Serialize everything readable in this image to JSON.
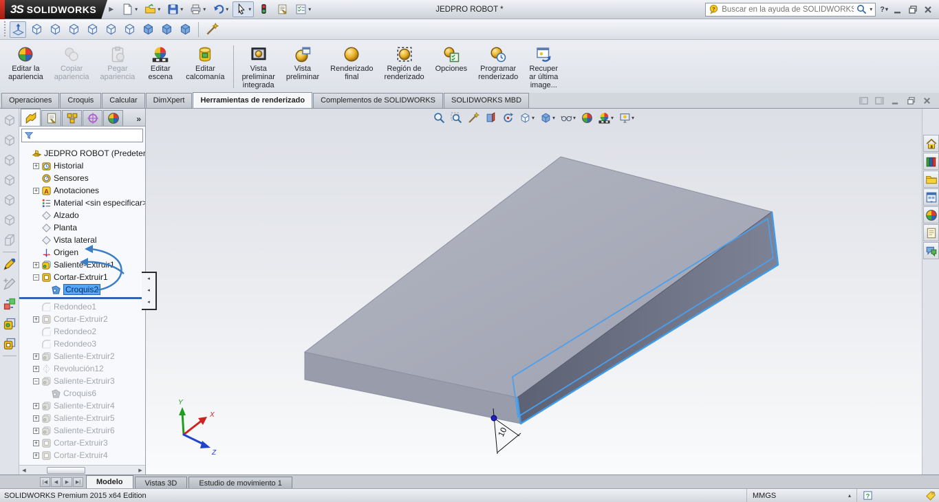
{
  "window": {
    "logo_prefix": "3S",
    "logo": "SOLIDWORKS",
    "title": "JEDPRO ROBOT *",
    "search": {
      "placeholder": "Buscar en la ayuda de SOLIDWORKS",
      "value": ""
    }
  },
  "quick_access_toolbar": [
    {
      "name": "new-document-button",
      "icon": "page",
      "dropdown": true
    },
    {
      "name": "open-button",
      "icon": "folder-open",
      "dropdown": true
    },
    {
      "name": "save-button",
      "icon": "floppy",
      "dropdown": true
    },
    {
      "name": "print-button",
      "icon": "printer",
      "dropdown": true
    },
    {
      "name": "undo-button",
      "icon": "undo",
      "dropdown": true
    },
    {
      "name": "select-button",
      "icon": "cursor",
      "dropdown": true,
      "pressed": true
    },
    {
      "name": "interference-button",
      "icon": "traffic-light"
    },
    {
      "name": "file-properties-button",
      "icon": "file-properties"
    },
    {
      "name": "options-button",
      "icon": "options-list",
      "dropdown": true
    }
  ],
  "views_toolbar": [
    {
      "name": "view-orientation-button",
      "icon": "orientation",
      "pressed": true
    },
    {
      "name": "view-front-button",
      "icon": "cube-wire"
    },
    {
      "name": "view-back-button",
      "icon": "cube-wire"
    },
    {
      "name": "view-left-button",
      "icon": "cube-wire"
    },
    {
      "name": "view-right-button",
      "icon": "cube-wire"
    },
    {
      "name": "view-top-button",
      "icon": "cube-wire"
    },
    {
      "name": "view-bottom-button",
      "icon": "cube-wire"
    },
    {
      "name": "view-isometric-button",
      "icon": "cube-solid"
    },
    {
      "name": "view-trimetric-button",
      "icon": "cube-solid"
    },
    {
      "name": "view-dimetric-button",
      "icon": "cube-solid"
    },
    {
      "sep": true
    },
    {
      "name": "magic-wand-button",
      "icon": "wand"
    }
  ],
  "ribbon": {
    "buttons": [
      {
        "name": "edit-appearance-button",
        "label": "Editar la\napariencia",
        "icon": "sphere-color"
      },
      {
        "name": "copy-appearance-button",
        "label": "Copiar\napariencia",
        "icon": "spheres-gray",
        "disabled": true
      },
      {
        "name": "paste-appearance-button",
        "label": "Pegar\napariencia",
        "icon": "clipboard",
        "disabled": true
      },
      {
        "name": "edit-scene-button",
        "label": "Editar\nescena",
        "icon": "sphere-scene"
      },
      {
        "name": "edit-decal-button",
        "label": "Editar\ncalcomanía",
        "icon": "decal"
      },
      {
        "sep": true
      },
      {
        "name": "integrated-preview-button",
        "label": "Vista\npreliminar\nintegrada",
        "icon": "preview-integrated"
      },
      {
        "name": "preview-window-button",
        "label": "Vista\npreliminar",
        "icon": "preview-window"
      },
      {
        "name": "final-render-button",
        "label": "Renderizado\nfinal",
        "icon": "sphere-gold"
      },
      {
        "name": "render-region-button",
        "label": "Región de\nrenderizado",
        "icon": "render-region"
      },
      {
        "name": "render-options-button",
        "label": "Opciones",
        "icon": "render-options"
      },
      {
        "name": "schedule-render-button",
        "label": "Programar\nrenderizado",
        "icon": "render-schedule"
      },
      {
        "name": "recall-last-image-button",
        "label": "Recuper\nar última\nimage...",
        "icon": "recall-image"
      }
    ]
  },
  "command_tabs": [
    {
      "name": "tab-operaciones",
      "label": "Operaciones"
    },
    {
      "name": "tab-croquis",
      "label": "Croquis"
    },
    {
      "name": "tab-calcular",
      "label": "Calcular"
    },
    {
      "name": "tab-dimxpert",
      "label": "DimXpert"
    },
    {
      "name": "tab-herramientas-de-renderizado",
      "label": "Herramientas de renderizado",
      "active": true
    },
    {
      "name": "tab-complementos",
      "label": "Complementos de SOLIDWORKS"
    },
    {
      "name": "tab-solidworks-mbd",
      "label": "SOLIDWORKS MBD"
    }
  ],
  "doc_window_controls": [
    {
      "name": "split-pane-left-button",
      "icon": "split-left"
    },
    {
      "name": "split-pane-right-button",
      "icon": "split-right"
    },
    {
      "name": "doc-minimize-button",
      "icon": "win-min"
    },
    {
      "name": "doc-restore-button",
      "icon": "win-restore"
    },
    {
      "name": "doc-close-button",
      "icon": "win-close"
    }
  ],
  "left_toolbar": [
    {
      "name": "standard-view-1-button",
      "icon": "cube-gray"
    },
    {
      "name": "standard-view-2-button",
      "icon": "cube-gray"
    },
    {
      "name": "standard-view-3-button",
      "icon": "cube-gray"
    },
    {
      "name": "standard-view-4-button",
      "icon": "cube-gray"
    },
    {
      "name": "standard-view-5-button",
      "icon": "cube-gray"
    },
    {
      "name": "standard-view-6-button",
      "icon": "cube-gray"
    },
    {
      "name": "standard-view-7-button",
      "icon": "cube-corner"
    },
    {
      "sep": true
    },
    {
      "name": "sketch-button",
      "icon": "sketch-pencil"
    },
    {
      "name": "sketch-3d-button",
      "icon": "sketch-pencil-gray"
    },
    {
      "name": "edit-component-button",
      "icon": "component"
    },
    {
      "name": "insert-boss-button",
      "icon": "boss-yellow"
    },
    {
      "name": "insert-cut-button",
      "icon": "boss-yellow2"
    },
    {
      "sep": true
    }
  ],
  "feature_panel": {
    "manager_tabs": [
      {
        "name": "featuremanager-tab",
        "icon": "fm-tree",
        "active": true
      },
      {
        "name": "propertymanager-tab",
        "icon": "pm-form"
      },
      {
        "name": "configurationmanager-tab",
        "icon": "cfg-blocks"
      },
      {
        "name": "dimxpertmanager-tab",
        "icon": "dimxpert-target"
      },
      {
        "name": "displaymanager-tab",
        "icon": "sphere-color"
      }
    ],
    "overflow": "»",
    "filter": {
      "value": "",
      "placeholder": ""
    },
    "tree": [
      {
        "name": "tree-item-root",
        "label": "JEDPRO ROBOT  (Predetermina",
        "icon": "part",
        "level": 0
      },
      {
        "name": "tree-item-historial",
        "label": "Historial",
        "icon": "history",
        "level": 1,
        "expander": "plus"
      },
      {
        "name": "tree-item-sensores",
        "label": "Sensores",
        "icon": "sensors",
        "level": 1
      },
      {
        "name": "tree-item-anotaciones",
        "label": "Anotaciones",
        "icon": "annotations",
        "level": 1,
        "expander": "plus"
      },
      {
        "name": "tree-item-material",
        "label": "Material <sin especificar>",
        "icon": "material",
        "level": 1
      },
      {
        "name": "tree-item-alzado",
        "label": "Alzado",
        "icon": "plane",
        "level": 1
      },
      {
        "name": "tree-item-planta",
        "label": "Planta",
        "icon": "plane",
        "level": 1
      },
      {
        "name": "tree-item-vista-lateral",
        "label": "Vista lateral",
        "icon": "plane",
        "level": 1
      },
      {
        "name": "tree-item-origen",
        "label": "Origen",
        "icon": "origin",
        "level": 1
      },
      {
        "name": "tree-item-saliente-extruir1",
        "label": "Saliente-Extruir1",
        "icon": "boss-extrude",
        "level": 1,
        "expander": "plus"
      },
      {
        "name": "tree-item-cortar-extruir1",
        "label": "Cortar-Extruir1",
        "icon": "cut-extrude",
        "level": 1,
        "expander": "minus"
      },
      {
        "name": "tree-item-croquis2",
        "label": "Croquis2",
        "icon": "sketch",
        "level": 2,
        "state": "selected"
      },
      {
        "rollback": true
      },
      {
        "name": "tree-item-redondeo1",
        "label": "Redondeo1",
        "icon": "fillet",
        "level": 1,
        "state": "suppressed"
      },
      {
        "name": "tree-item-cortar-extruir2",
        "label": "Cortar-Extruir2",
        "icon": "cut-extrude",
        "level": 1,
        "expander": "plus",
        "state": "suppressed"
      },
      {
        "name": "tree-item-redondeo2",
        "label": "Redondeo2",
        "icon": "fillet",
        "level": 1,
        "state": "suppressed"
      },
      {
        "name": "tree-item-redondeo3",
        "label": "Redondeo3",
        "icon": "fillet",
        "level": 1,
        "state": "suppressed"
      },
      {
        "name": "tree-item-saliente-extruir2",
        "label": "Saliente-Extruir2",
        "icon": "boss-extrude",
        "level": 1,
        "expander": "plus",
        "state": "suppressed"
      },
      {
        "name": "tree-item-revolucion12",
        "label": "Revolución12",
        "icon": "revolve",
        "level": 1,
        "expander": "plus",
        "state": "suppressed"
      },
      {
        "name": "tree-item-saliente-extruir3",
        "label": "Saliente-Extruir3",
        "icon": "boss-extrude",
        "level": 1,
        "expander": "minus",
        "state": "suppressed"
      },
      {
        "name": "tree-item-croquis6",
        "label": "Croquis6",
        "icon": "sketch",
        "level": 2,
        "state": "suppressed"
      },
      {
        "name": "tree-item-saliente-extruir4",
        "label": "Saliente-Extruir4",
        "icon": "boss-extrude",
        "level": 1,
        "expander": "plus",
        "state": "suppressed"
      },
      {
        "name": "tree-item-saliente-extruir5",
        "label": "Saliente-Extruir5",
        "icon": "boss-extrude",
        "level": 1,
        "expander": "plus",
        "state": "suppressed"
      },
      {
        "name": "tree-item-saliente-extruir6",
        "label": "Saliente-Extruir6",
        "icon": "boss-extrude",
        "level": 1,
        "expander": "plus",
        "state": "suppressed"
      },
      {
        "name": "tree-item-cortar-extruir3",
        "label": "Cortar-Extruir3",
        "icon": "cut-extrude",
        "level": 1,
        "expander": "plus",
        "state": "suppressed"
      },
      {
        "name": "tree-item-cortar-extruir4",
        "label": "Cortar-Extruir4",
        "icon": "cut-extrude",
        "level": 1,
        "expander": "plus",
        "state": "suppressed"
      }
    ]
  },
  "heads_up_toolbar": [
    {
      "name": "zoom-to-fit-button",
      "icon": "magnifier"
    },
    {
      "name": "zoom-to-area-button",
      "icon": "magnifier-area"
    },
    {
      "name": "previous-view-button",
      "icon": "wand"
    },
    {
      "name": "section-view-button",
      "icon": "section"
    },
    {
      "name": "rotate-view-button",
      "icon": "rotate"
    },
    {
      "name": "view-orientation-dropdown",
      "icon": "cube-wire",
      "dropdown": true
    },
    {
      "name": "display-style-dropdown",
      "icon": "cube-solid",
      "dropdown": true
    },
    {
      "name": "hide-show-items-dropdown",
      "icon": "glasses",
      "dropdown": true
    },
    {
      "name": "edit-appearance-hud-button",
      "icon": "sphere-color"
    },
    {
      "name": "apply-scene-dropdown",
      "icon": "sphere-scene",
      "dropdown": true
    },
    {
      "name": "view-settings-dropdown",
      "icon": "monitor",
      "dropdown": true
    }
  ],
  "viewport": {
    "dimension_label": "10",
    "triad": {
      "x": "X",
      "y": "Y",
      "z": "Z"
    },
    "colors": {
      "face_top": "#a9acb9",
      "face_left": "#999cab",
      "face_front": "#6b6f83",
      "edge_highlight": "#3f9ceb",
      "background_top": "#dcdfe6",
      "background_bottom": "#fafbfc"
    }
  },
  "task_pane": [
    {
      "name": "solidworks-resources-tab",
      "icon": "home"
    },
    {
      "name": "design-library-tab",
      "icon": "library"
    },
    {
      "name": "file-explorer-tab",
      "icon": "folder"
    },
    {
      "name": "view-palette-tab",
      "icon": "palette"
    },
    {
      "name": "appearances-scenes-tab",
      "icon": "sphere-color"
    },
    {
      "name": "custom-properties-tab",
      "icon": "form"
    },
    {
      "name": "forum-tab",
      "icon": "chat"
    }
  ],
  "bottom_bar": {
    "nav": [
      {
        "name": "first-tab-button",
        "glyph": "|◀"
      },
      {
        "name": "prev-tab-button",
        "glyph": "◀"
      },
      {
        "name": "next-tab-button",
        "glyph": "▶"
      },
      {
        "name": "last-tab-button",
        "glyph": "▶|"
      }
    ],
    "tabs": [
      {
        "name": "modelo-tab",
        "label": "Modelo",
        "active": true
      },
      {
        "name": "vistas-3d-tab",
        "label": "Vistas 3D"
      },
      {
        "name": "estudio-movimiento-tab",
        "label": "Estudio de movimiento 1"
      }
    ]
  },
  "status_bar": {
    "message": "SOLIDWORKS Premium 2015 x64 Edition",
    "units": "MMGS"
  }
}
